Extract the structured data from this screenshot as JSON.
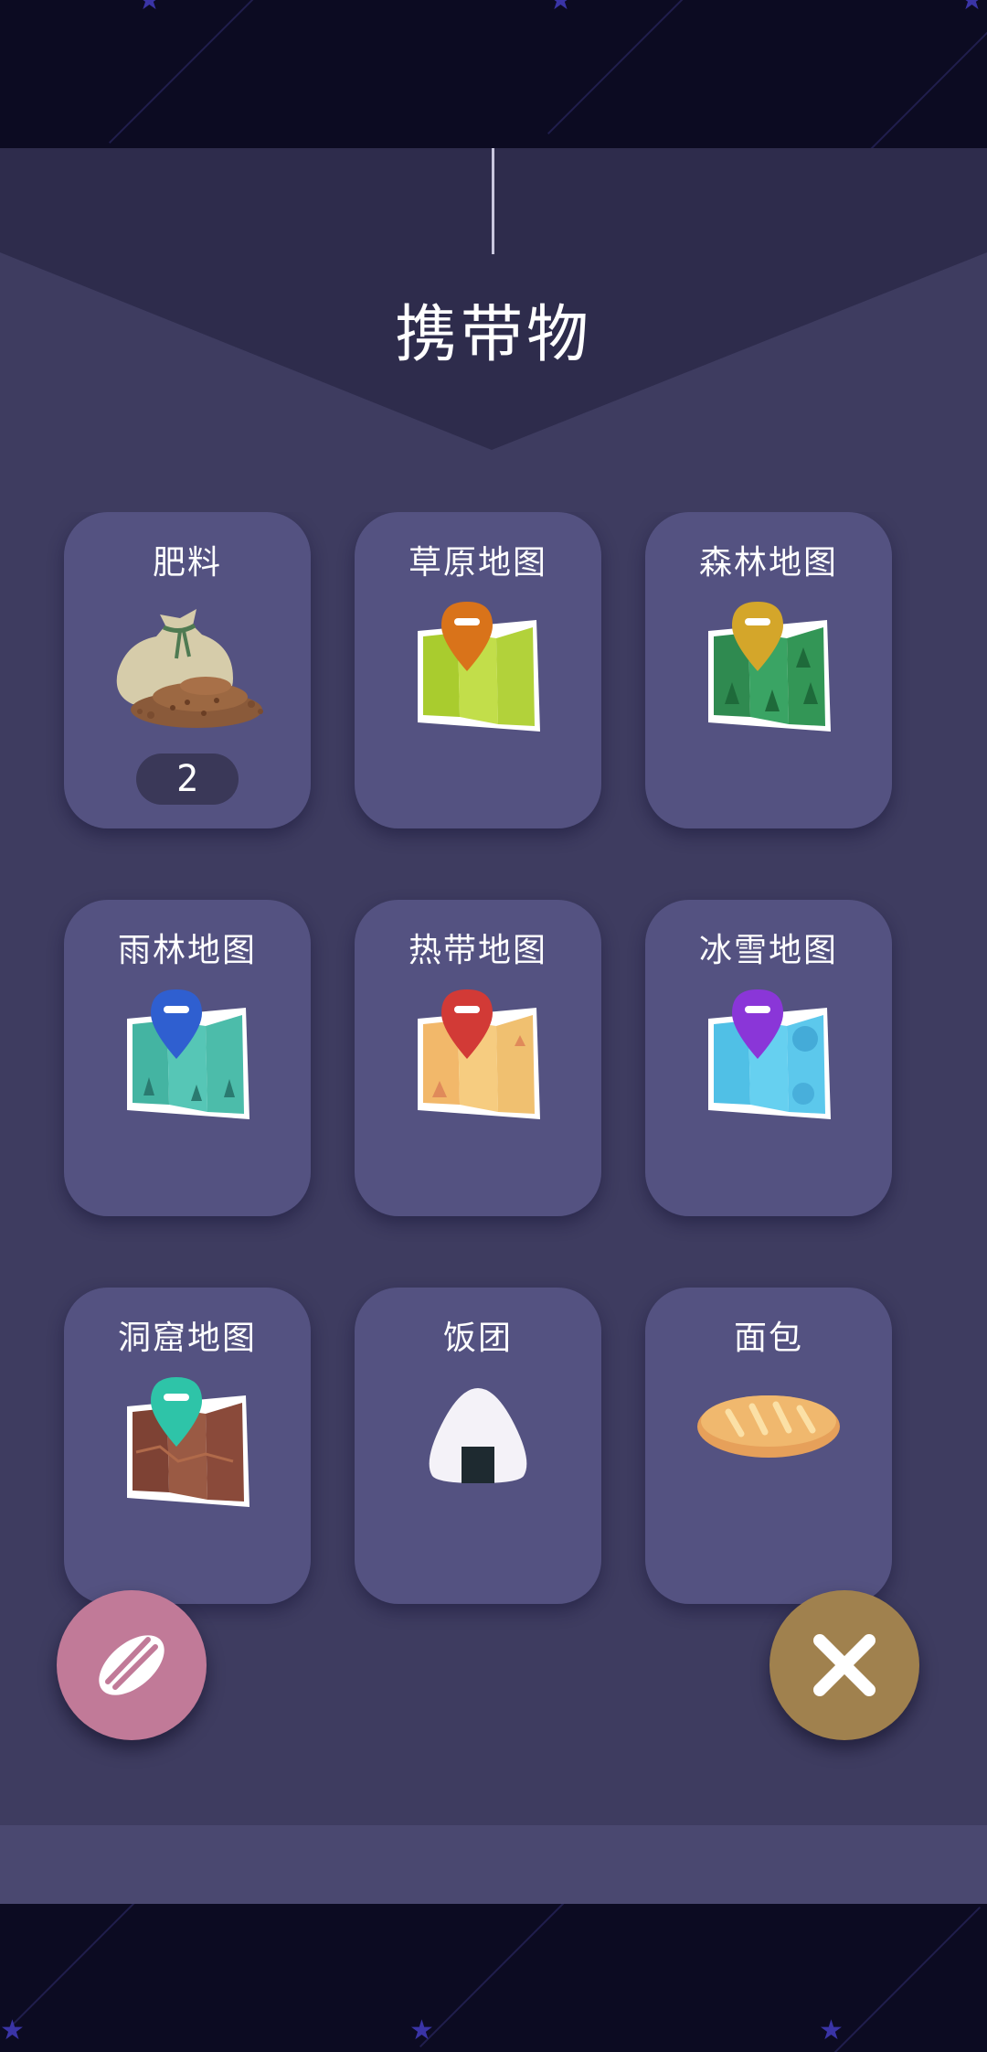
{
  "title": "携带物",
  "items": [
    {
      "label": "肥料",
      "icon": "fertilizer-bag-icon",
      "count": "2"
    },
    {
      "label": "草原地图",
      "icon": "grassland-map-icon",
      "pin_color": "#d9731a",
      "map_color": "#b8d84a"
    },
    {
      "label": "森林地图",
      "icon": "forest-map-icon",
      "pin_color": "#d4a62a",
      "map_color": "#3a9a5a"
    },
    {
      "label": "雨林地图",
      "icon": "rainforest-map-icon",
      "pin_color": "#2f5fd0",
      "map_color": "#4fc0b0"
    },
    {
      "label": "热带地图",
      "icon": "tropical-map-icon",
      "pin_color": "#d23a36",
      "map_color": "#f0c070"
    },
    {
      "label": "冰雪地图",
      "icon": "snow-map-icon",
      "pin_color": "#8a36d8",
      "map_color": "#5cc8ec"
    },
    {
      "label": "洞窟地图",
      "icon": "cave-map-icon",
      "pin_color": "#2ec4a8",
      "map_color": "#8a4a3a"
    },
    {
      "label": "饭团",
      "icon": "rice-ball-icon"
    },
    {
      "label": "面包",
      "icon": "bread-icon"
    }
  ],
  "buttons": {
    "seed": {
      "icon": "seed-icon",
      "color": "#c17a98"
    },
    "close": {
      "icon": "close-icon",
      "color": "#a0814e"
    }
  }
}
